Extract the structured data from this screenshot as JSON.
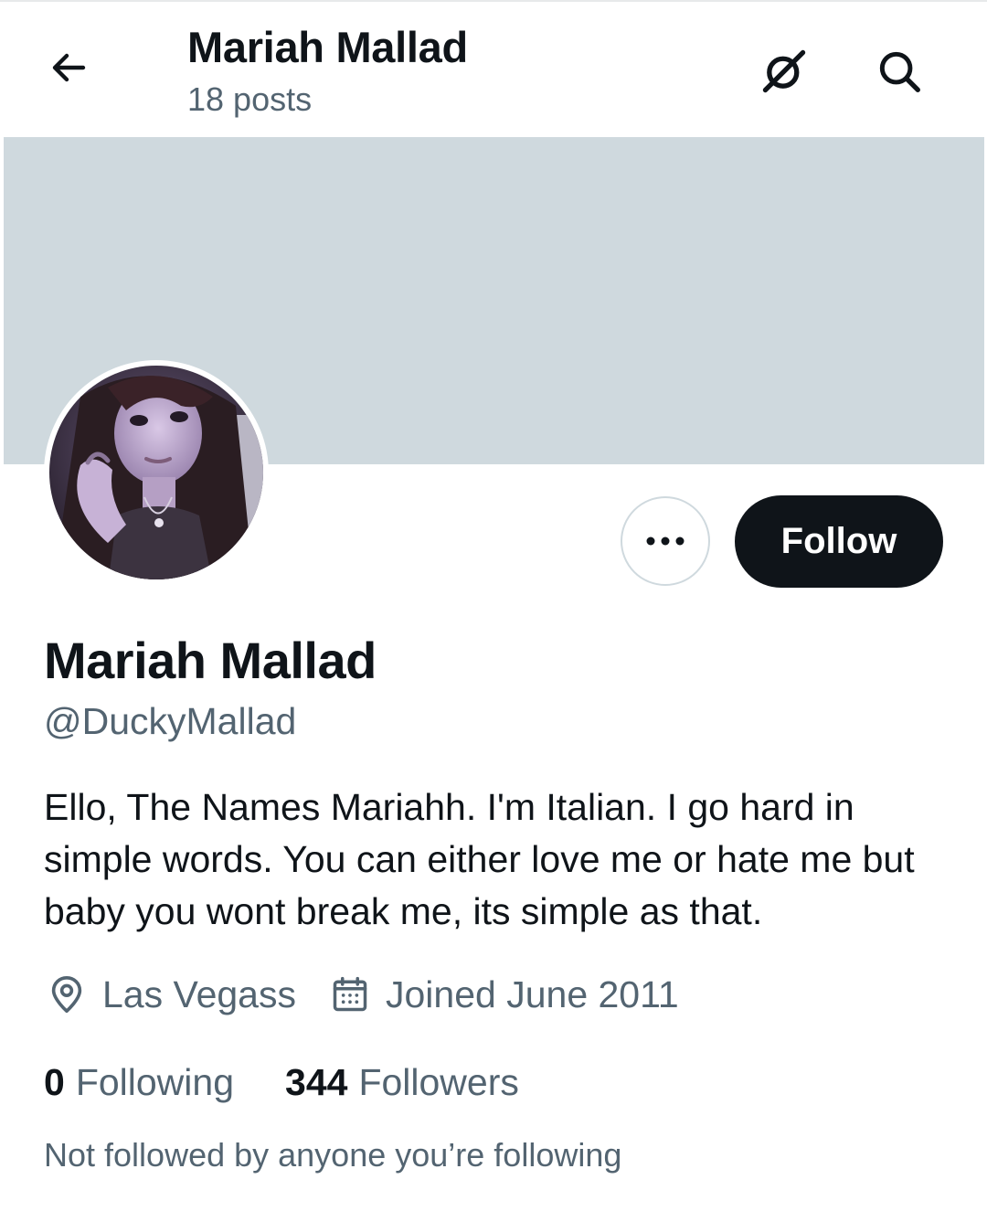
{
  "header": {
    "name": "Mariah Mallad",
    "posts": "18 posts"
  },
  "icons": {
    "back": "back-arrow-icon",
    "grok": "grok-icon",
    "search": "search-icon",
    "more": "more-horizontal-icon",
    "location": "location-pin-icon",
    "calendar": "calendar-icon"
  },
  "banner": {
    "color": "#cfd9de"
  },
  "actions": {
    "follow_label": "Follow"
  },
  "profile": {
    "name": "Mariah Mallad",
    "handle": "@DuckyMallad",
    "bio": "Ello, The Names Mariahh. I'm Italian. I go hard in simple words. You can either love me or hate me but baby you wont break me, its simple as that.",
    "location": "Las Vegass",
    "joined": "Joined June 2011"
  },
  "stats": {
    "following_count": "0",
    "following_label": "Following",
    "followers_count": "344",
    "followers_label": "Followers"
  },
  "social_context": "Not followed by anyone you’re following",
  "colors": {
    "text_primary": "#0f1419",
    "text_secondary": "#536471",
    "follow_button_bg": "#0f1419",
    "border": "#cfd9de"
  }
}
